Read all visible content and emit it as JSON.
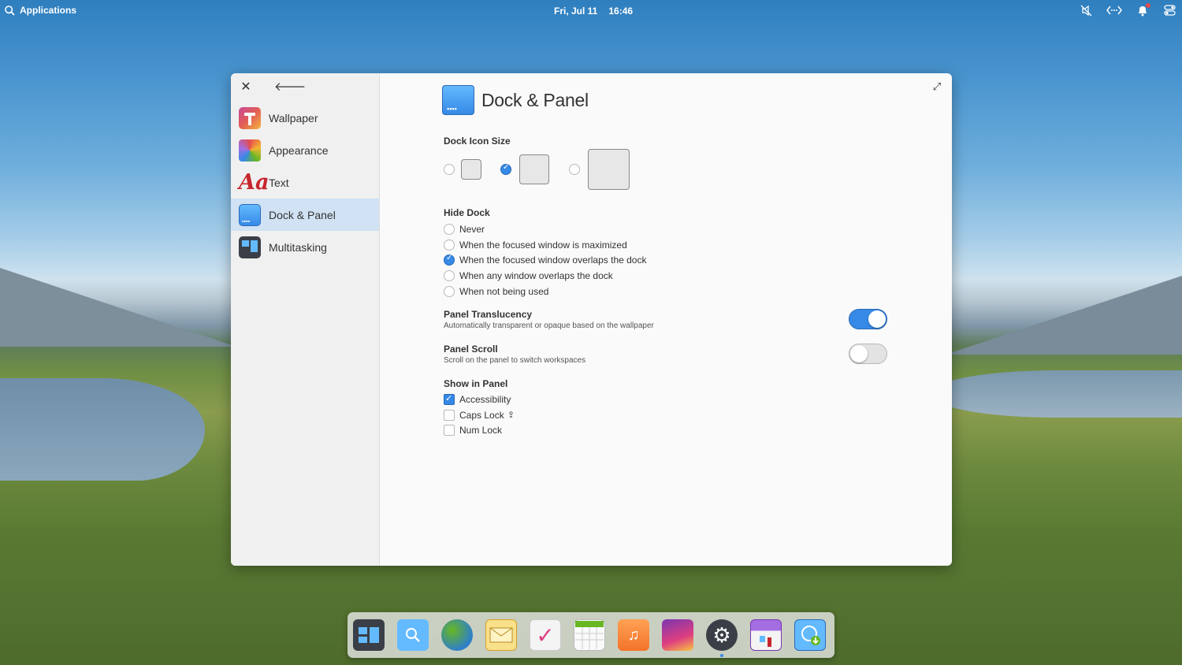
{
  "top_panel": {
    "applications_label": "Applications",
    "date": "Fri, Jul 11",
    "time": "16:46"
  },
  "sidebar": {
    "items": [
      {
        "label": "Wallpaper",
        "icon": "wallpaper-icon",
        "selected": false
      },
      {
        "label": "Appearance",
        "icon": "appearance-icon",
        "selected": false
      },
      {
        "label": "Text",
        "icon": "text-icon",
        "selected": false
      },
      {
        "label": "Dock & Panel",
        "icon": "dock-panel-icon",
        "selected": true
      },
      {
        "label": "Multitasking",
        "icon": "multitasking-icon",
        "selected": false
      }
    ]
  },
  "page": {
    "title": "Dock & Panel",
    "dock_icon_size": {
      "label": "Dock Icon Size",
      "options": [
        "small",
        "medium",
        "large"
      ],
      "selected": "medium"
    },
    "hide_dock": {
      "label": "Hide Dock",
      "options": [
        {
          "label": "Never",
          "checked": false
        },
        {
          "label": "When the focused window is maximized",
          "checked": false
        },
        {
          "label": "When the focused window overlaps the dock",
          "checked": true
        },
        {
          "label": "When any window overlaps the dock",
          "checked": false
        },
        {
          "label": "When not being used",
          "checked": false
        }
      ]
    },
    "panel_translucency": {
      "title": "Panel Translucency",
      "subtitle": "Automatically transparent or opaque based on the wallpaper",
      "on": true
    },
    "panel_scroll": {
      "title": "Panel Scroll",
      "subtitle": "Scroll on the panel to switch workspaces",
      "on": false
    },
    "show_in_panel": {
      "label": "Show in Panel",
      "items": [
        {
          "label": "Accessibility",
          "checked": true
        },
        {
          "label": "Caps Lock",
          "suffix_icon": "caps-lock-icon",
          "checked": false
        },
        {
          "label": "Num Lock",
          "checked": false
        }
      ]
    }
  },
  "dock": {
    "apps": [
      {
        "icon": "multitasking-view-icon",
        "color": "#3a3f47"
      },
      {
        "icon": "files-icon",
        "color": "#3689e6"
      },
      {
        "icon": "web-browser-icon",
        "color": "#2e9bd6"
      },
      {
        "icon": "mail-icon",
        "color": "#f9c440"
      },
      {
        "icon": "tasks-icon",
        "color": "#f4f4f4"
      },
      {
        "icon": "calendar-icon",
        "color": "#68b723"
      },
      {
        "icon": "music-icon",
        "color": "#f37329"
      },
      {
        "icon": "photos-icon",
        "color": "#a56de2"
      },
      {
        "icon": "system-settings-icon",
        "color": "#3a3f47",
        "running": true
      },
      {
        "icon": "appcenter-icon",
        "color": "#7a36b1"
      },
      {
        "icon": "installer-icon",
        "color": "#3689e6"
      }
    ]
  }
}
